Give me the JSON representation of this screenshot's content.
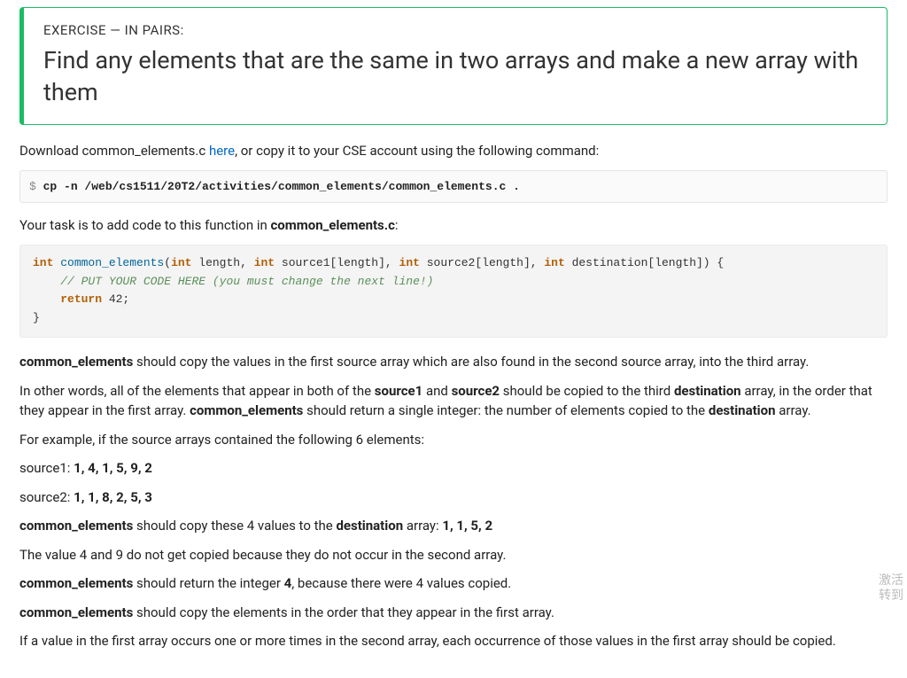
{
  "exercise": {
    "label": "EXERCISE — IN PAIRS:",
    "title": "Find any elements that are the same in two arrays and make a new array with them"
  },
  "download": {
    "pre": "Download common_elements.c ",
    "link": "here",
    "post": ", or copy it to your CSE account using the following command:"
  },
  "cmd": {
    "prompt": "$ ",
    "text": "cp -n /web/cs1511/20T2/activities/common_elements/common_elements.c ."
  },
  "task": {
    "pre": "Your task is to add code to this function in ",
    "file": "common_elements.c",
    "post": ":"
  },
  "code": {
    "kw_int": "int",
    "fn": "common_elements",
    "sig_a": "(",
    "sig_b": " length, ",
    "sig_c": " source1[length], ",
    "sig_d": " source2[length], ",
    "sig_e": " destination[length]) {",
    "comment": "// PUT YOUR CODE HERE (you must change the next line!)",
    "ret_kw": "return",
    "ret_val": " 42;",
    "close": "}"
  },
  "p1": {
    "b1": "common_elements",
    "t1": " should copy the values in the first source array which are also found in the second source array, into the third array."
  },
  "p2": {
    "t1": "In other words, all of the elements that appear in both of the ",
    "b1": "source1",
    "t2": " and ",
    "b2": "source2",
    "t3": " should be copied to the third ",
    "b3": "destination",
    "t4": " array, in the order that they appear in the first array. ",
    "b4": "common_elements",
    "t5": " should return a single integer: the number of elements copied to the ",
    "b5": "destination",
    "t6": " array."
  },
  "p3": "For example, if the source arrays contained the following 6 elements:",
  "src1": {
    "label": "source1: ",
    "vals": "1, 4, 1, 5, 9, 2"
  },
  "src2": {
    "label": "source2: ",
    "vals": "1, 1, 8, 2, 5, 3"
  },
  "p4": {
    "b1": "common_elements",
    "t1": " should copy these 4 values to the ",
    "b2": "destination",
    "t2": " array: ",
    "b3": "1, 1, 5, 2"
  },
  "p5": "The value 4 and 9 do not get copied because they do not occur in the second array.",
  "p6": {
    "b1": "common_elements",
    "t1": " should return the integer ",
    "b2": "4",
    "t2": ", because there were 4 values copied."
  },
  "p7": {
    "b1": "common_elements",
    "t1": " should copy the elements in the order that they appear in the first array."
  },
  "p8": "If a value in the first array occurs one or more times in the second array, each occurrence of those values in the first array should be copied.",
  "watermark": {
    "l1": "激活",
    "l2": "转到"
  }
}
